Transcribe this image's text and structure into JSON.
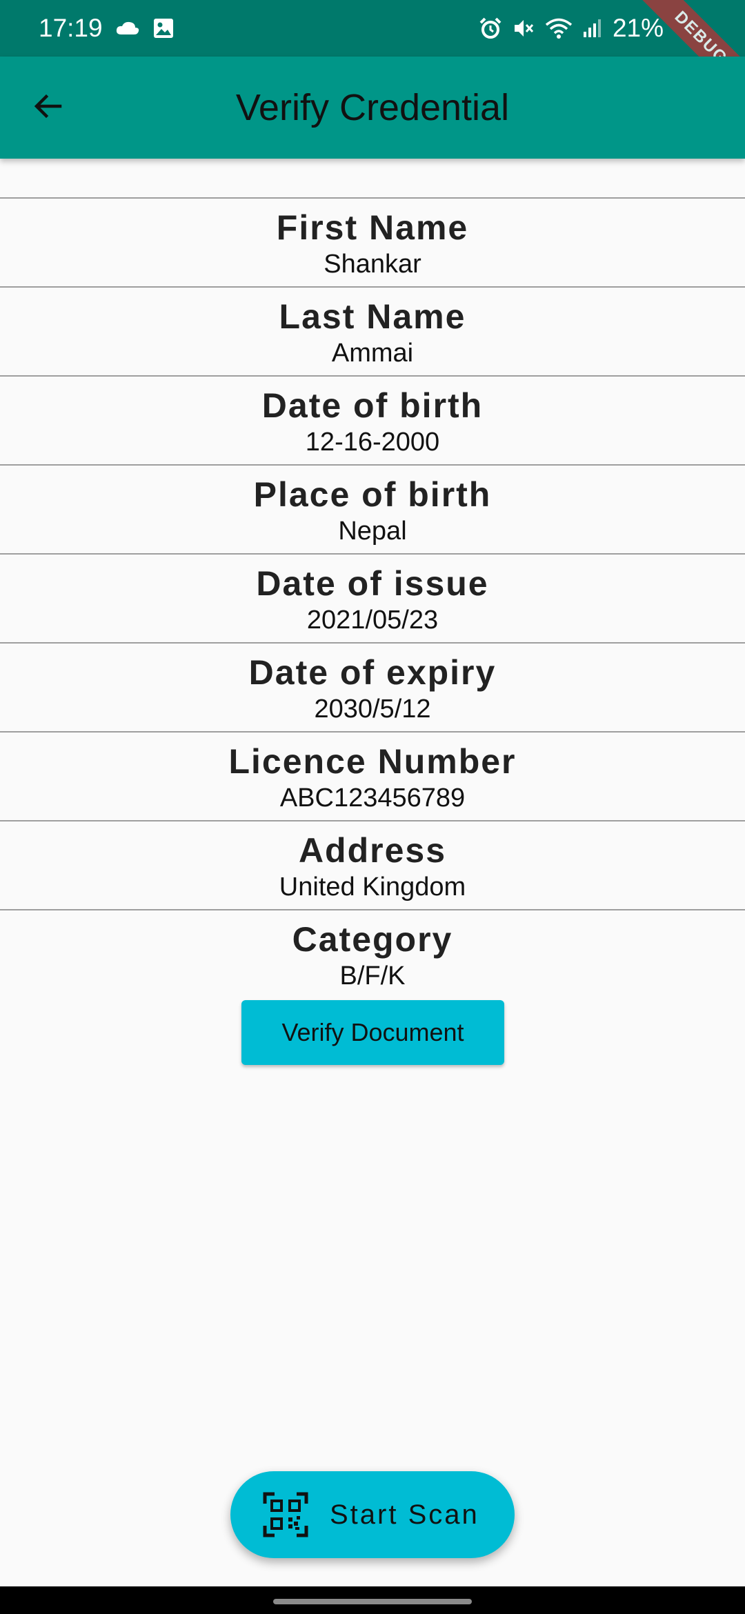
{
  "status_bar": {
    "time": "17:19",
    "battery": "21%",
    "icons": [
      "cloud-icon",
      "image-icon",
      "alarm-icon",
      "mute-icon",
      "wifi-icon",
      "signal-icon",
      "battery-icon"
    ]
  },
  "debug_banner": "DEBUG",
  "app_bar": {
    "title": "Verify Credential",
    "back_icon": "arrow-back-icon"
  },
  "fields": [
    {
      "label": "First Name",
      "value": "Shankar"
    },
    {
      "label": "Last Name",
      "value": "Ammai"
    },
    {
      "label": "Date of birth",
      "value": "12-16-2000"
    },
    {
      "label": "Place of birth",
      "value": "Nepal"
    },
    {
      "label": "Date of issue",
      "value": "2021/05/23"
    },
    {
      "label": "Date of expiry",
      "value": "2030/5/12"
    },
    {
      "label": "Licence Number",
      "value": "ABC123456789"
    },
    {
      "label": "Address",
      "value": "United Kingdom"
    },
    {
      "label": "Category",
      "value": "B/F/K"
    }
  ],
  "verify_button": {
    "label": "Verify Document"
  },
  "scan_fab": {
    "label": "Start Scan",
    "icon": "qr-code-scan-icon"
  },
  "colors": {
    "status_bar": "#00796b",
    "app_bar": "#009688",
    "button": "#00bcd4",
    "background": "#fafafa"
  }
}
